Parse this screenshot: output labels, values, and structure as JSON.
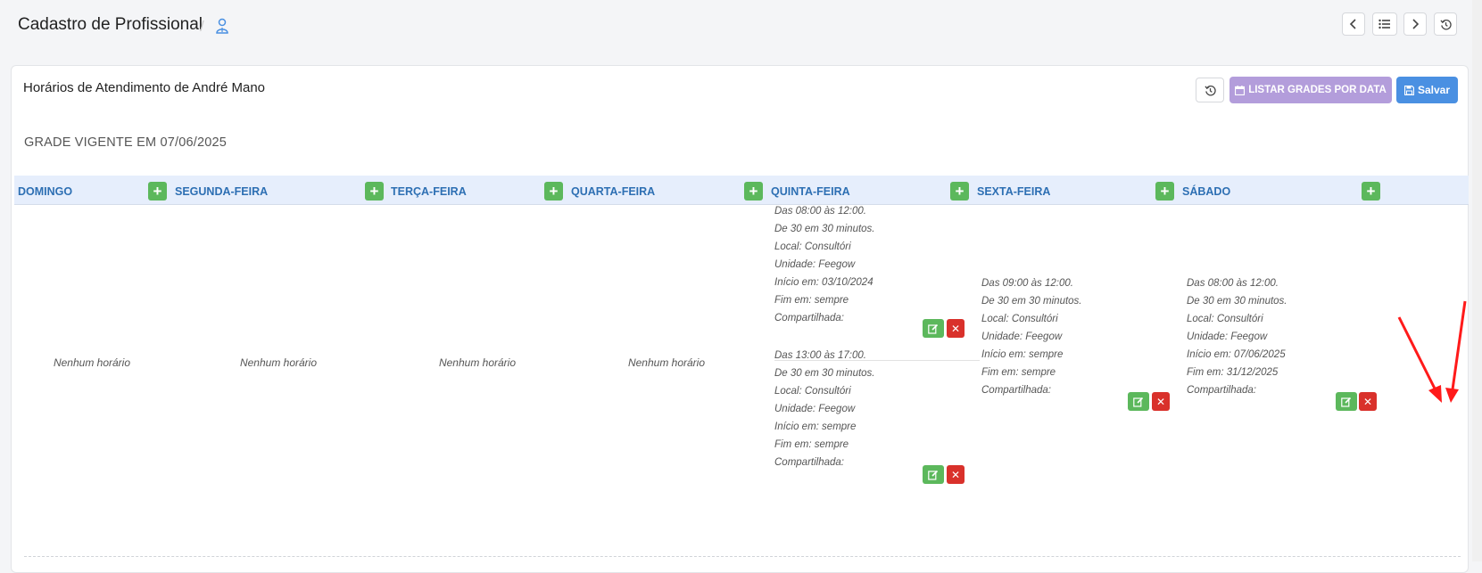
{
  "header": {
    "title": "Cadastro de Profissional",
    "breadcrumb_separator": "/",
    "icon": "user-icon",
    "nav_buttons": [
      "chevron-left-icon",
      "list-icon",
      "chevron-right-icon",
      "history-icon"
    ]
  },
  "panel": {
    "title": "Horários de Atendimento de André Mano",
    "history_icon": "history-icon",
    "list_button_label": "LISTAR GRADES POR DATA",
    "save_button_label": "Salvar"
  },
  "grade_title": "GRADE VIGENTE EM 07/06/2025",
  "days": [
    {
      "label": "DOMINGO"
    },
    {
      "label": "SEGUNDA-FEIRA"
    },
    {
      "label": "TERÇA-FEIRA"
    },
    {
      "label": "QUARTA-FEIRA"
    },
    {
      "label": "QUINTA-FEIRA"
    },
    {
      "label": "SEXTA-FEIRA"
    },
    {
      "label": "SÁBADO"
    }
  ],
  "empty_text": "Nenhum horário",
  "quinta": [
    {
      "lines": [
        "Das 08:00 às 12:00.",
        "De 30 em 30 minutos.",
        "Local: Consultóri",
        "Unidade: Feegow",
        "Início em: 03/10/2024",
        "Fim em: sempre",
        "Compartilhada:"
      ]
    },
    {
      "lines": [
        "Das 13:00 às 17:00.",
        "De 30 em 30 minutos.",
        "Local: Consultóri",
        "Unidade: Feegow",
        "Início em: sempre",
        "Fim em: sempre",
        "Compartilhada:"
      ]
    }
  ],
  "sexta": [
    {
      "lines": [
        "Das 09:00 às 12:00.",
        "De 30 em 30 minutos.",
        "Local: Consultóri",
        "Unidade: Feegow",
        "Início em: sempre",
        "Fim em: sempre",
        "Compartilhada:"
      ]
    }
  ],
  "sabado": [
    {
      "lines": [
        "Das 08:00 às 12:00.",
        "De 30 em 30 minutos.",
        "Local: Consultóri",
        "Unidade: Feegow",
        "Início em: 07/06/2025",
        "Fim em: 31/12/2025",
        "Compartilhada:"
      ]
    }
  ],
  "colors": {
    "plus": "#5cb85c",
    "delete": "#d9312b",
    "save": "#4a90e2",
    "list": "#b39ddb",
    "day_label": "#2d6fb3",
    "annotation_arrow": "#ff1a1a"
  }
}
